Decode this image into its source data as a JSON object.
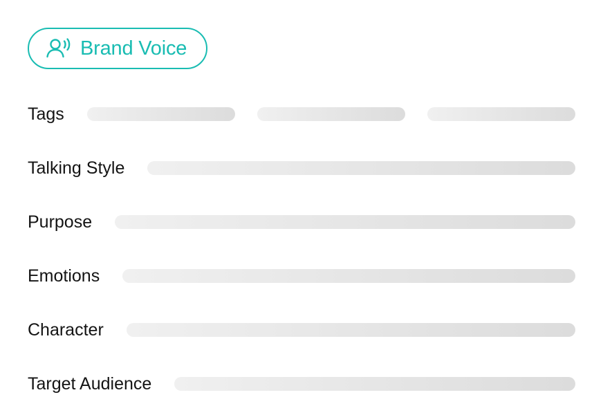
{
  "brand_voice": {
    "label": "Brand Voice",
    "icon": "speaking-person-icon",
    "accent_color": "#19bcb2"
  },
  "fields": [
    {
      "label": "Tags"
    },
    {
      "label": "Talking Style"
    },
    {
      "label": "Purpose"
    },
    {
      "label": "Emotions"
    },
    {
      "label": "Character"
    },
    {
      "label": "Target Audience"
    }
  ]
}
